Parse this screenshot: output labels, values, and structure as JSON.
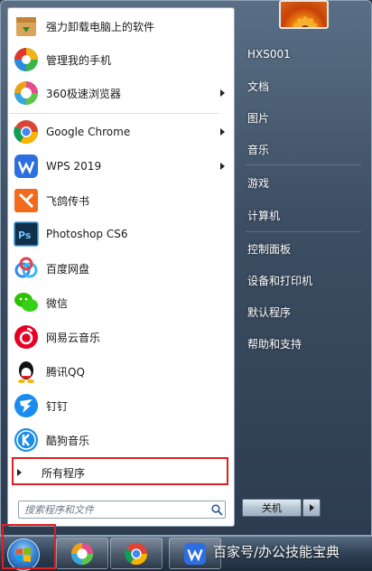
{
  "programs": [
    {
      "label": "强力卸载电脑上的软件",
      "icon": "uninstall-box-icon",
      "has_submenu": false
    },
    {
      "label": "管理我的手机",
      "icon": "phone-manager-icon",
      "has_submenu": false
    },
    {
      "label": "360极速浏览器",
      "icon": "360-browser-icon",
      "has_submenu": true
    },
    {
      "label": "Google Chrome",
      "icon": "chrome-icon",
      "has_submenu": true
    },
    {
      "label": "WPS 2019",
      "icon": "wps-icon",
      "has_submenu": true
    },
    {
      "label": "飞鸽传书",
      "icon": "feige-icon",
      "has_submenu": false
    },
    {
      "label": "Photoshop CS6",
      "icon": "photoshop-icon",
      "has_submenu": false
    },
    {
      "label": "百度网盘",
      "icon": "baidu-netdisk-icon",
      "has_submenu": false
    },
    {
      "label": "微信",
      "icon": "wechat-icon",
      "has_submenu": false
    },
    {
      "label": "网易云音乐",
      "icon": "netease-music-icon",
      "has_submenu": false
    },
    {
      "label": "腾讯QQ",
      "icon": "qq-icon",
      "has_submenu": false
    },
    {
      "label": "钉钉",
      "icon": "dingtalk-icon",
      "has_submenu": false
    },
    {
      "label": "酷狗音乐",
      "icon": "kugou-icon",
      "has_submenu": false
    }
  ],
  "all_programs_label": "所有程序",
  "search": {
    "placeholder": "搜索程序和文件"
  },
  "right_panel": {
    "items": [
      "HXS001",
      "文档",
      "图片",
      "音乐",
      "游戏",
      "计算机",
      "控制面板",
      "设备和打印机",
      "默认程序",
      "帮助和支持"
    ]
  },
  "shutdown_label": "关机",
  "taskbar": {
    "watermark": "百家号/办公技能宝典"
  },
  "colors": {
    "highlight": "#e02020",
    "panel_bg": "#ffffff",
    "frame": "#3d4f64"
  }
}
